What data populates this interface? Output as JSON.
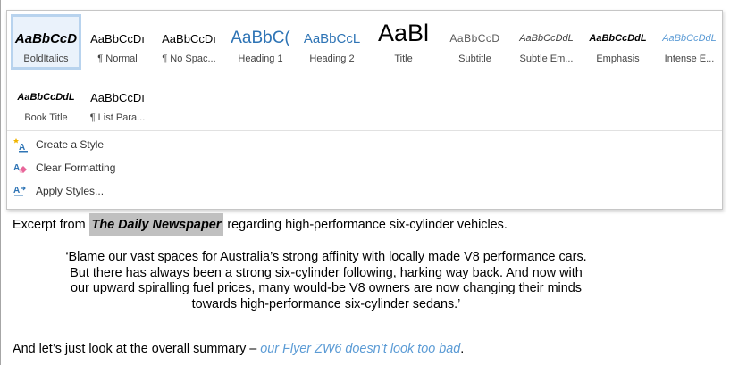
{
  "styles_gallery": {
    "tiles": [
      {
        "preview": "AaBbCcD",
        "name": "BoldItalics",
        "selected": true
      },
      {
        "preview": "AaBbCcDı",
        "name": "¶ Normal"
      },
      {
        "preview": "AaBbCcDı",
        "name": "¶ No Spac..."
      },
      {
        "preview": "AaBbC(",
        "name": "Heading 1"
      },
      {
        "preview": "AaBbCcL",
        "name": "Heading 2"
      },
      {
        "preview": "AaBl",
        "name": "Title"
      },
      {
        "preview": "AaBbCcD",
        "name": "Subtitle"
      },
      {
        "preview": "AaBbCcDdL",
        "name": "Subtle Em..."
      },
      {
        "preview": "AaBbCcDdL",
        "name": "Emphasis"
      },
      {
        "preview": "AaBbCcDdL",
        "name": "Intense E..."
      },
      {
        "preview": "AaBbCcDdL",
        "name": "Book Title"
      },
      {
        "preview": "AaBbCcDı",
        "name": "¶ List Para..."
      }
    ]
  },
  "menu": {
    "create_style": "Create a Style",
    "clear_formatting": "Clear Formatting",
    "apply_styles": "Apply Styles..."
  },
  "document": {
    "intro_before": "Excerpt from ",
    "intro_highlight": "The Daily Newspaper",
    "intro_after": " regarding high-performance six-cylinder vehicles.",
    "quote": "‘Blame our vast spaces for Australia’s strong affinity with locally made V8 performance cars. But there has always been a strong six-cylinder following, harking way back. And now with our upward spiralling fuel prices, many would-be V8 owners are now changing their minds towards high-performance six-cylinder sedans.’",
    "summary_before": "And let’s just look at the overall summary – ",
    "summary_link": "our Flyer ZW6 doesn’t look too bad",
    "summary_after": "."
  },
  "colors": {
    "selected_border": "#b8d3ee",
    "heading_blue": "#2e74b5",
    "link_blue": "#5b9bd5",
    "highlight_gray": "#c0c0c0"
  }
}
